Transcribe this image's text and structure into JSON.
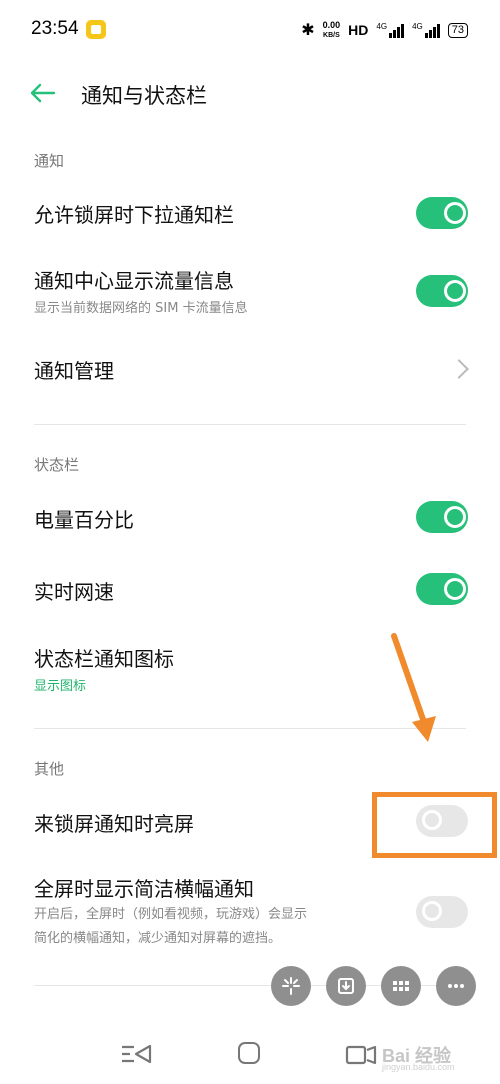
{
  "status_bar": {
    "time": "23:54",
    "net_speed_value": "0.00",
    "net_speed_unit": "KB/S",
    "hd_label": "HD",
    "signal1_label": "4G",
    "signal2_label": "4G",
    "battery": "73"
  },
  "header": {
    "title": "通知与状态栏"
  },
  "sections": {
    "notification": {
      "label": "通知",
      "items": [
        {
          "title": "允许锁屏时下拉通知栏",
          "toggle": "on"
        },
        {
          "title": "通知中心显示流量信息",
          "subtitle": "显示当前数据网络的 SIM 卡流量信息",
          "toggle": "on"
        },
        {
          "title": "通知管理"
        }
      ]
    },
    "statusbar": {
      "label": "状态栏",
      "items": [
        {
          "title": "电量百分比",
          "toggle": "on"
        },
        {
          "title": "实时网速",
          "toggle": "on"
        },
        {
          "title": "状态栏通知图标",
          "subtitle": "显示图标"
        }
      ]
    },
    "other": {
      "label": "其他",
      "items": [
        {
          "title": "来锁屏通知时亮屏",
          "toggle": "off"
        },
        {
          "title": "全屏时显示简洁横幅通知",
          "subtitle_line1": "开启后，全屏时（例如看视频，玩游戏）会显示",
          "subtitle_line2": "简化的横幅通知，减少通知对屏幕的遮挡。",
          "toggle": "off"
        }
      ]
    }
  },
  "watermark": {
    "text": "Bai 经验",
    "sub": "jingyan.baidu.com"
  },
  "colors": {
    "accent": "#27c07a",
    "highlight": "#f08a2c",
    "toggle_off": "#e7e7e7"
  }
}
